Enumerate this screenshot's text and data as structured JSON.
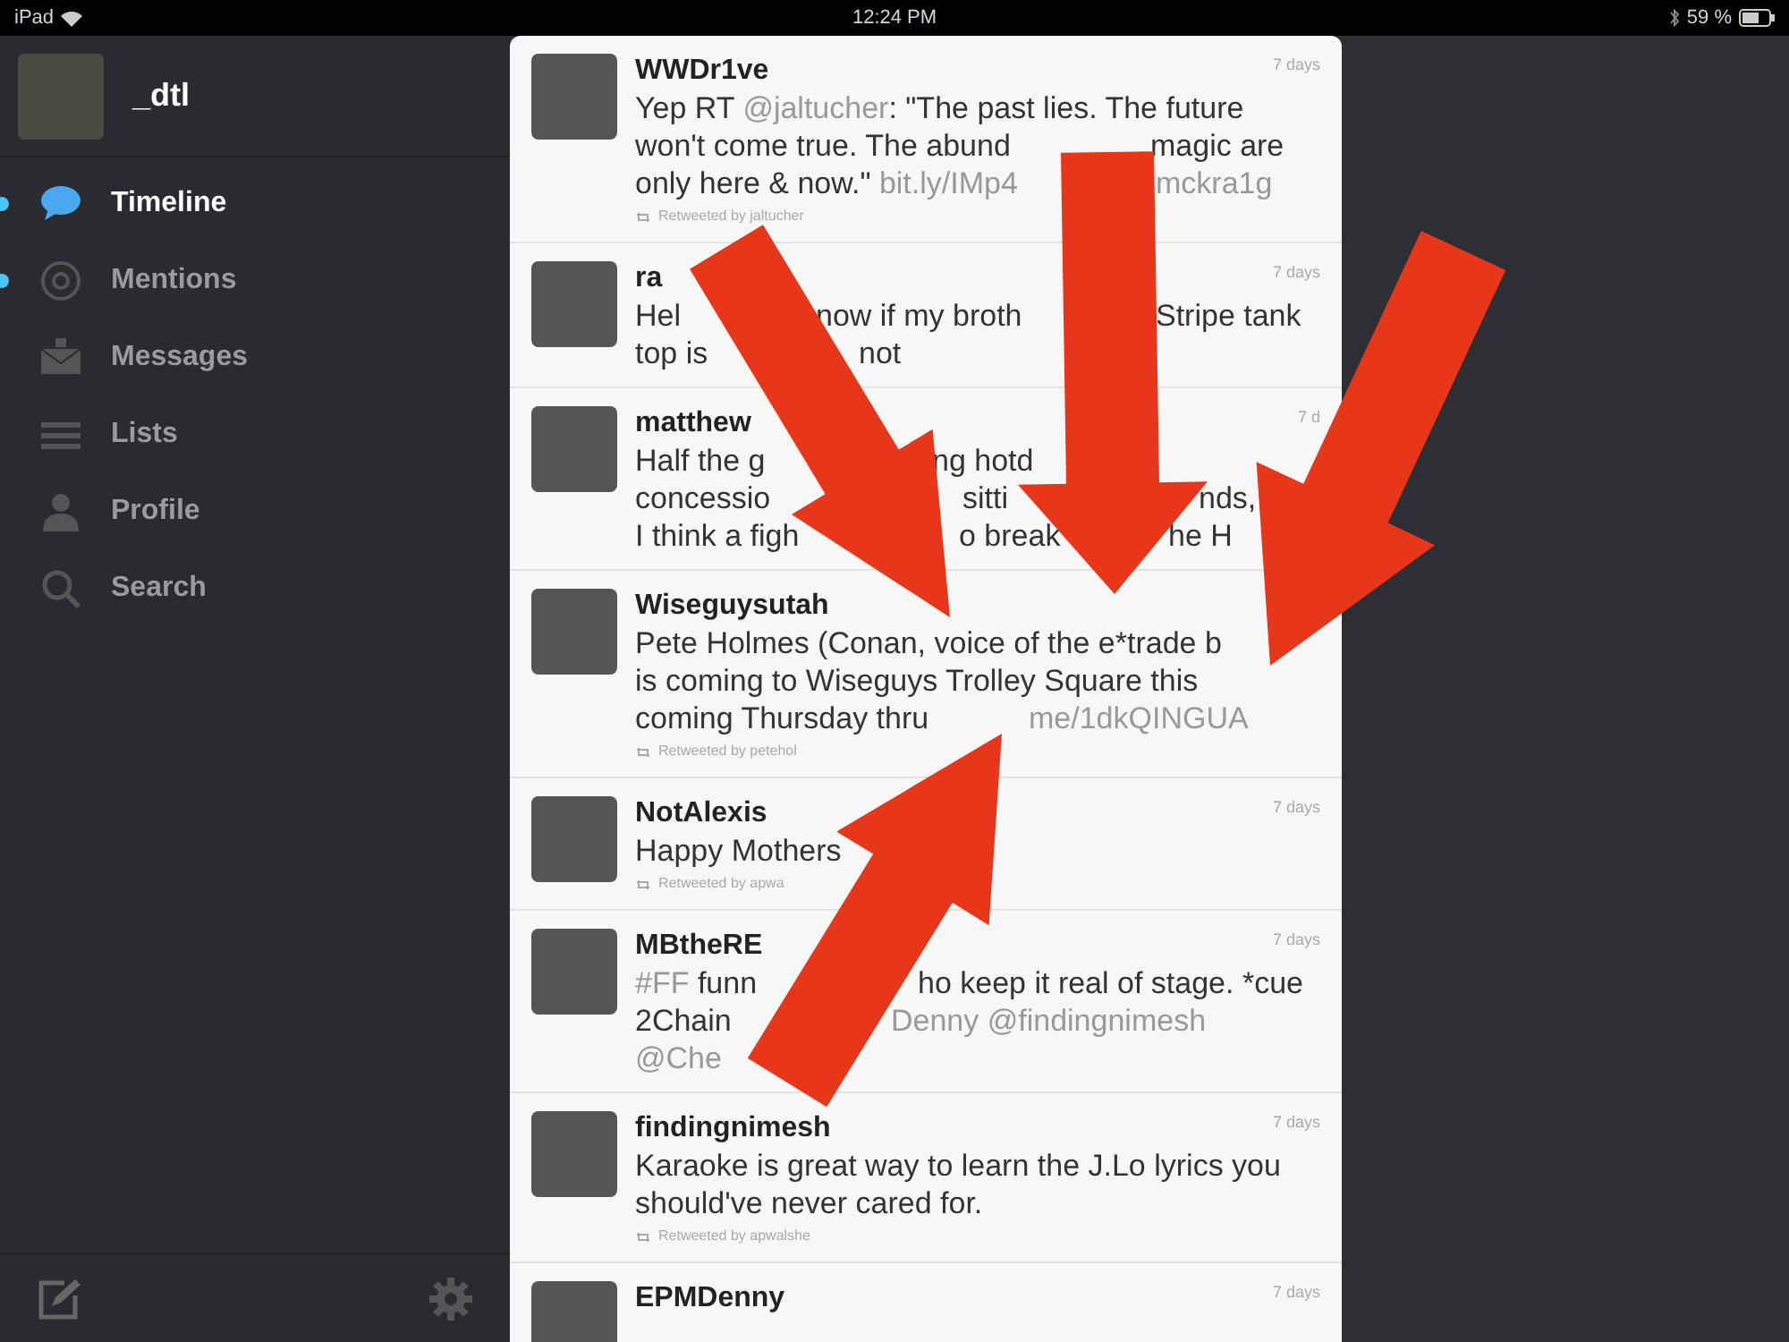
{
  "status_bar": {
    "carrier": "iPad",
    "time": "12:24 PM",
    "battery": "59 %"
  },
  "sidebar": {
    "account": {
      "name": "_dtl"
    },
    "items": [
      {
        "label": "Timeline",
        "selected": true,
        "unread": true
      },
      {
        "label": "Mentions",
        "selected": false,
        "unread": true
      },
      {
        "label": "Messages",
        "selected": false,
        "unread": false
      },
      {
        "label": "Lists",
        "selected": false,
        "unread": false
      },
      {
        "label": "Profile",
        "selected": false,
        "unread": false
      },
      {
        "label": "Search",
        "selected": false,
        "unread": false
      }
    ]
  },
  "tweets": [
    {
      "name": "WWDr1ve",
      "time": "7 days",
      "lines": [
        [
          "Yep RT ",
          {
            "kind": "link",
            "text": "@jaltucher"
          },
          ": \"The past lies. The future"
        ],
        [
          "won't come true. The abund",
          "magic are"
        ],
        [
          "only here & now.\" ",
          {
            "kind": "link",
            "text": "bit.ly/IMp4"
          },
          {
            "kind": "link",
            "text": "mckra1g"
          }
        ]
      ],
      "retweet": "Retweeted by jaltucher"
    },
    {
      "name": "ra",
      "time": "7 days",
      "lines": [
        [
          "Hel",
          "now if my broth",
          "Stripe tank"
        ],
        [
          "top is",
          "not"
        ]
      ]
    },
    {
      "name": "matthew",
      "time": "7 d",
      "lines": [
        [
          "Half the g",
          "ng hotd"
        ],
        [
          "concessio",
          "sitti",
          "nds,"
        ],
        [
          "I think a figh",
          "o break",
          "he H"
        ]
      ]
    },
    {
      "name": "Wiseguysutah",
      "lines": [
        [
          "Pete Holmes (Conan, voice of the e*trade b"
        ],
        [
          "is coming to Wiseguys Trolley Square this"
        ],
        [
          "coming Thursday thru",
          {
            "kind": "link",
            "text": "me/1dkQINGUA"
          }
        ]
      ],
      "retweet": "Retweeted by petehol"
    },
    {
      "name": "NotAlexis",
      "time": "7 days",
      "lines": [
        [
          "Happy Mothers"
        ]
      ],
      "retweet": "Retweeted by apwa"
    },
    {
      "name": "MBtheRE",
      "time": "7 days",
      "lines": [
        [
          {
            "kind": "link",
            "text": "#FF"
          },
          " funn",
          "ho keep it real of stage. *cue"
        ],
        [
          "2Chain",
          {
            "kind": "link",
            "text": "Denny @findingnimesh"
          }
        ],
        [
          {
            "kind": "link",
            "text": "@Che"
          }
        ]
      ]
    },
    {
      "name": "findingnimesh",
      "time": "7 days",
      "lines": [
        [
          "Karaoke is great way to learn the J.Lo lyrics you"
        ],
        [
          "should've never cared for."
        ]
      ],
      "retweet": "Retweeted by apwalshe"
    },
    {
      "name": "EPMDenny",
      "time": "7 days"
    }
  ]
}
